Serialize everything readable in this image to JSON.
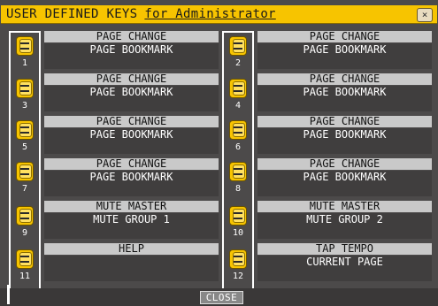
{
  "window": {
    "title": "USER DEFINED KEYS",
    "subtitle": "for Administrator",
    "close_icon": "×"
  },
  "keys": [
    {
      "number": "1",
      "function": "PAGE CHANGE",
      "parameter": "PAGE BOOKMARK"
    },
    {
      "number": "2",
      "function": "PAGE CHANGE",
      "parameter": "PAGE BOOKMARK"
    },
    {
      "number": "3",
      "function": "PAGE CHANGE",
      "parameter": "PAGE BOOKMARK"
    },
    {
      "number": "4",
      "function": "PAGE CHANGE",
      "parameter": "PAGE BOOKMARK"
    },
    {
      "number": "5",
      "function": "PAGE CHANGE",
      "parameter": "PAGE BOOKMARK"
    },
    {
      "number": "6",
      "function": "PAGE CHANGE",
      "parameter": "PAGE BOOKMARK"
    },
    {
      "number": "7",
      "function": "PAGE CHANGE",
      "parameter": "PAGE BOOKMARK"
    },
    {
      "number": "8",
      "function": "PAGE CHANGE",
      "parameter": "PAGE BOOKMARK"
    },
    {
      "number": "9",
      "function": "MUTE MASTER",
      "parameter": "MUTE GROUP 1"
    },
    {
      "number": "10",
      "function": "MUTE MASTER",
      "parameter": "MUTE GROUP 2"
    },
    {
      "number": "11",
      "function": "HELP",
      "parameter": ""
    },
    {
      "number": "12",
      "function": "TAP TEMPO",
      "parameter": "CURRENT PAGE"
    }
  ],
  "footer": {
    "close_label": "CLOSE"
  },
  "colors": {
    "accent": "#f7c400",
    "background": "#4c4a4a",
    "header": "#c9c9c9"
  }
}
